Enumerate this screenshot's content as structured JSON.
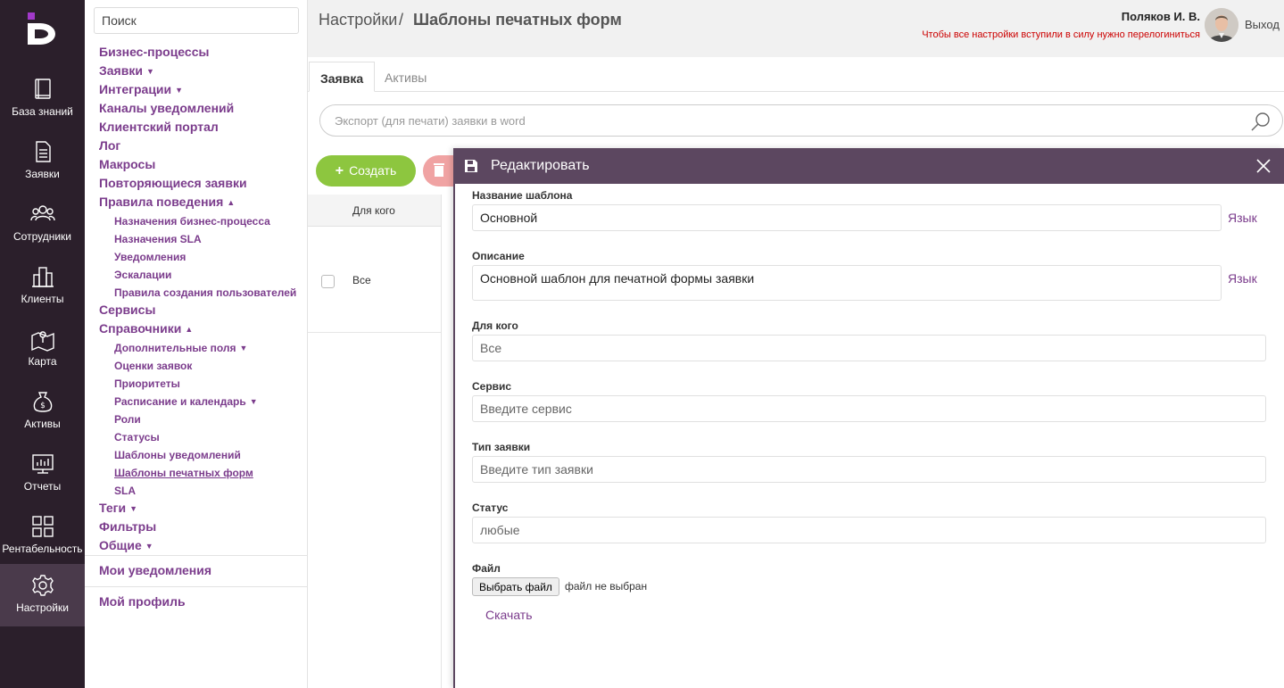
{
  "rail": {
    "items": [
      {
        "label": "База знаний",
        "icon": "book-icon"
      },
      {
        "label": "Заявки",
        "icon": "document-icon"
      },
      {
        "label": "Сотрудники",
        "icon": "users-icon"
      },
      {
        "label": "Клиенты",
        "icon": "building-icon"
      },
      {
        "label": "Карта",
        "icon": "map-icon"
      },
      {
        "label": "Активы",
        "icon": "money-bag-icon"
      },
      {
        "label": "Отчеты",
        "icon": "monitor-chart-icon"
      },
      {
        "label": "Рентабельность",
        "icon": "grid-icon"
      },
      {
        "label": "Настройки",
        "icon": "gear-icon"
      }
    ],
    "active": "Настройки",
    "colors": {
      "background": "#2b1f2b",
      "active": "#4a3a4b",
      "logo_accent": "#a239ca"
    }
  },
  "menu": {
    "search_placeholder": "Поиск",
    "items": {
      "business_processes": "Бизнес-процессы",
      "requests": "Заявки",
      "integrations": "Интеграции",
      "notification_channels": "Каналы уведомлений",
      "client_portal": "Клиентский портал",
      "log": "Лог",
      "macros": "Макросы",
      "recurring_requests": "Повторяющиеся заявки",
      "behavior_rules": "Правила поведения",
      "bp_assignments": "Назначения бизнес-процесса",
      "sla_assignments": "Назначения SLA",
      "notifications": "Уведомления",
      "escalations": "Эскалации",
      "user_creation_rules": "Правила создания пользователей",
      "services": "Сервисы",
      "directories": "Справочники",
      "extra_fields": "Дополнительные поля",
      "request_ratings": "Оценки заявок",
      "priorities": "Приоритеты",
      "schedule_calendar": "Расписание и календарь",
      "roles": "Роли",
      "statuses": "Статусы",
      "notification_templates": "Шаблоны уведомлений",
      "print_templates": "Шаблоны печатных форм",
      "sla": "SLA",
      "tags": "Теги",
      "filters": "Фильтры",
      "general": "Общие",
      "my_notifications": "Мои уведомления",
      "my_profile": "Мой профиль"
    },
    "arrow_down": "▼",
    "arrow_up": "▲",
    "accent_color": "#7b3c8c"
  },
  "header": {
    "breadcrumb_root": "Настройки",
    "breadcrumb_sep": "/",
    "breadcrumb_current": "Шаблоны печатных форм",
    "user_name": "Поляков И. В.",
    "warning": "Чтобы все настройки вступили в силу нужно перелогиниться",
    "logout": "Выход"
  },
  "tabs": [
    {
      "label": "Заявка",
      "active": true
    },
    {
      "label": "Активы",
      "active": false
    }
  ],
  "search": {
    "placeholder": "Экспорт (для печати) заявки в word"
  },
  "actions": {
    "create": "Создать",
    "plus": "+"
  },
  "table": {
    "header_whom": "Для кого",
    "rows": [
      {
        "whom": "Все"
      }
    ]
  },
  "edit_panel": {
    "title": "Редактировать",
    "fields": {
      "name_label": "Название шаблона",
      "name_value": "Основной",
      "description_label": "Описание",
      "description_value": "Основной шаблон для печатной формы заявки",
      "whom_label": "Для кого",
      "whom_value": "Все",
      "service_label": "Сервис",
      "service_placeholder": "Введите сервис",
      "request_type_label": "Тип заявки",
      "request_type_placeholder": "Введите тип заявки",
      "status_label": "Статус",
      "status_value": "любые",
      "file_label": "Файл"
    },
    "lang_link": "Язык",
    "file_button": "Выбрать файл",
    "file_status": "файл не выбран",
    "download": "Скачать",
    "header_color": "#5c4760"
  }
}
